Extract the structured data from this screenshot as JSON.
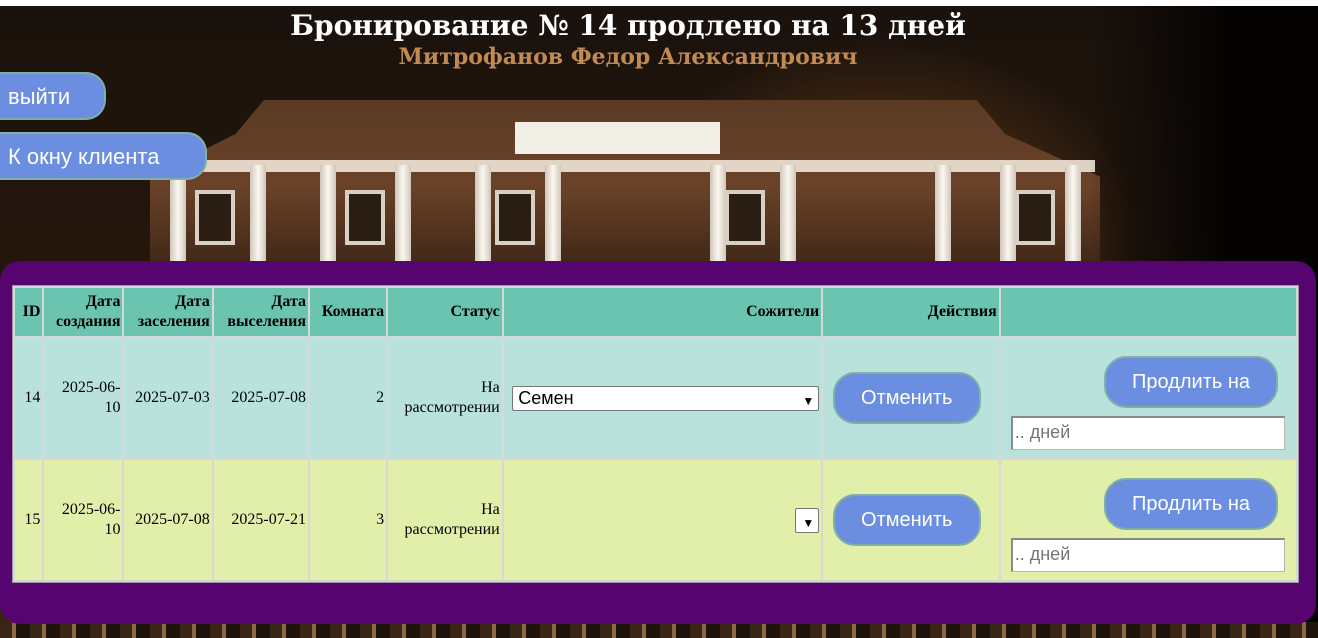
{
  "header": {
    "title": "Бронирование № 14 продлено на 13 дней",
    "client_name": "Митрофанов Федор Александрович"
  },
  "nav": {
    "exit_label": "выйти",
    "client_window_label": "К окну клиента"
  },
  "table": {
    "columns": [
      "ID",
      "Дата создания",
      "Дата заселения",
      "Дата выселения",
      "Комната",
      "Статус",
      "Сожители",
      "Действия",
      ""
    ],
    "rows": [
      {
        "id": "14",
        "created": "2025-06-10",
        "checkin": "2025-07-03",
        "checkout": "2025-07-08",
        "room": "2",
        "status": "На рассмотрении",
        "roommates_selected": "Семен",
        "cancel_label": "Отменить",
        "extend_label": "Продлить на",
        "days_placeholder": ".. дней"
      },
      {
        "id": "15",
        "created": "2025-06-10",
        "checkin": "2025-07-08",
        "checkout": "2025-07-21",
        "room": "3",
        "status": "На рассмотрении",
        "roommates_selected": "",
        "cancel_label": "Отменить",
        "extend_label": "Продлить на",
        "days_placeholder": ".. дней"
      }
    ]
  },
  "colors": {
    "panel": "#560470",
    "header_row": "#6ac4b0",
    "row1": "#b9e2dc",
    "row2": "#e1efab",
    "button": "#6c8ee0"
  }
}
